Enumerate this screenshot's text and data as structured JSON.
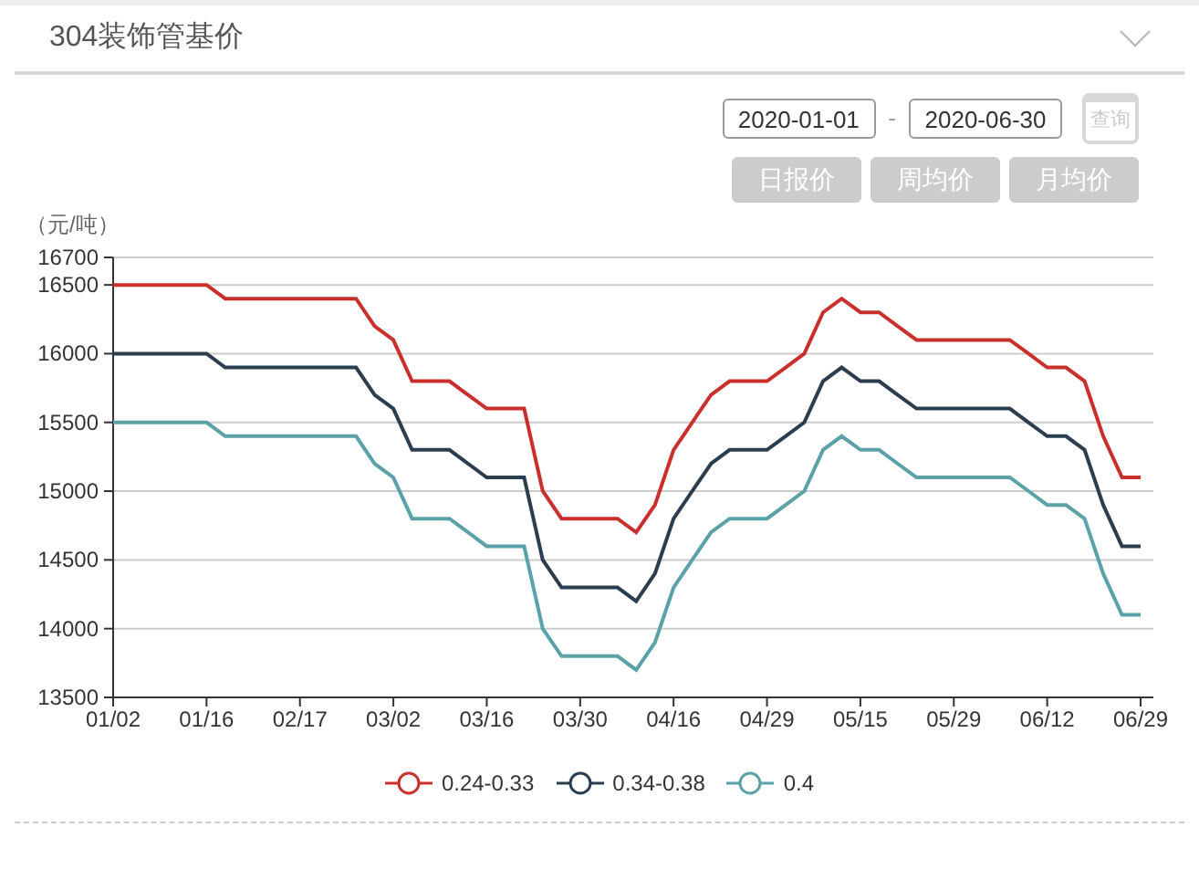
{
  "header": {
    "title": "304装饰管基价"
  },
  "date_range": {
    "start": "2020-01-01",
    "separator": "-",
    "end": "2020-06-30",
    "query_label": "查询"
  },
  "price_buttons": [
    {
      "label": "日报价"
    },
    {
      "label": "周均价"
    },
    {
      "label": "月均价"
    }
  ],
  "chart": {
    "unit": "（元/吨）",
    "chart_data": {
      "type": "line",
      "categories": [
        "01/02",
        null,
        null,
        null,
        null,
        "01/16",
        null,
        null,
        null,
        null,
        "02/17",
        null,
        null,
        null,
        null,
        "03/02",
        null,
        null,
        null,
        null,
        "03/16",
        null,
        null,
        null,
        null,
        "03/30",
        null,
        null,
        null,
        null,
        "04/16",
        null,
        null,
        null,
        null,
        "04/29",
        null,
        null,
        null,
        null,
        "05/15",
        null,
        null,
        null,
        null,
        "05/29",
        null,
        null,
        null,
        null,
        "06/12",
        null,
        null,
        null,
        null,
        "06/29"
      ],
      "ylim": [
        13500,
        16700
      ],
      "grid": true,
      "yticks": [
        13500,
        14000,
        14500,
        15000,
        15500,
        16000,
        16500,
        16700
      ],
      "series": [
        {
          "name": "0.24-0.33",
          "color": "#c9302c",
          "values": [
            16500,
            16500,
            16500,
            16500,
            16500,
            16500,
            16400,
            16400,
            16400,
            16400,
            16400,
            16400,
            16400,
            16400,
            16200,
            16100,
            15800,
            15800,
            15800,
            15700,
            15600,
            15600,
            15600,
            15000,
            14800,
            14800,
            14800,
            14800,
            14700,
            14900,
            15300,
            15500,
            15700,
            15800,
            15800,
            15800,
            15900,
            16000,
            16300,
            16400,
            16300,
            16300,
            16200,
            16100,
            16100,
            16100,
            16100,
            16100,
            16100,
            16000,
            15900,
            15900,
            15800,
            15400,
            15100,
            15100
          ]
        },
        {
          "name": "0.34-0.38",
          "color": "#2b3e50",
          "values": [
            16000,
            16000,
            16000,
            16000,
            16000,
            16000,
            15900,
            15900,
            15900,
            15900,
            15900,
            15900,
            15900,
            15900,
            15700,
            15600,
            15300,
            15300,
            15300,
            15200,
            15100,
            15100,
            15100,
            14500,
            14300,
            14300,
            14300,
            14300,
            14200,
            14400,
            14800,
            15000,
            15200,
            15300,
            15300,
            15300,
            15400,
            15500,
            15800,
            15900,
            15800,
            15800,
            15700,
            15600,
            15600,
            15600,
            15600,
            15600,
            15600,
            15500,
            15400,
            15400,
            15300,
            14900,
            14600,
            14600
          ]
        },
        {
          "name": "0.4",
          "color": "#5ba1a8",
          "values": [
            15500,
            15500,
            15500,
            15500,
            15500,
            15500,
            15400,
            15400,
            15400,
            15400,
            15400,
            15400,
            15400,
            15400,
            15200,
            15100,
            14800,
            14800,
            14800,
            14700,
            14600,
            14600,
            14600,
            14000,
            13800,
            13800,
            13800,
            13800,
            13700,
            13900,
            14300,
            14500,
            14700,
            14800,
            14800,
            14800,
            14900,
            15000,
            15300,
            15400,
            15300,
            15300,
            15200,
            15100,
            15100,
            15100,
            15100,
            15100,
            15100,
            15000,
            14900,
            14900,
            14800,
            14400,
            14100,
            14100
          ]
        }
      ]
    }
  }
}
